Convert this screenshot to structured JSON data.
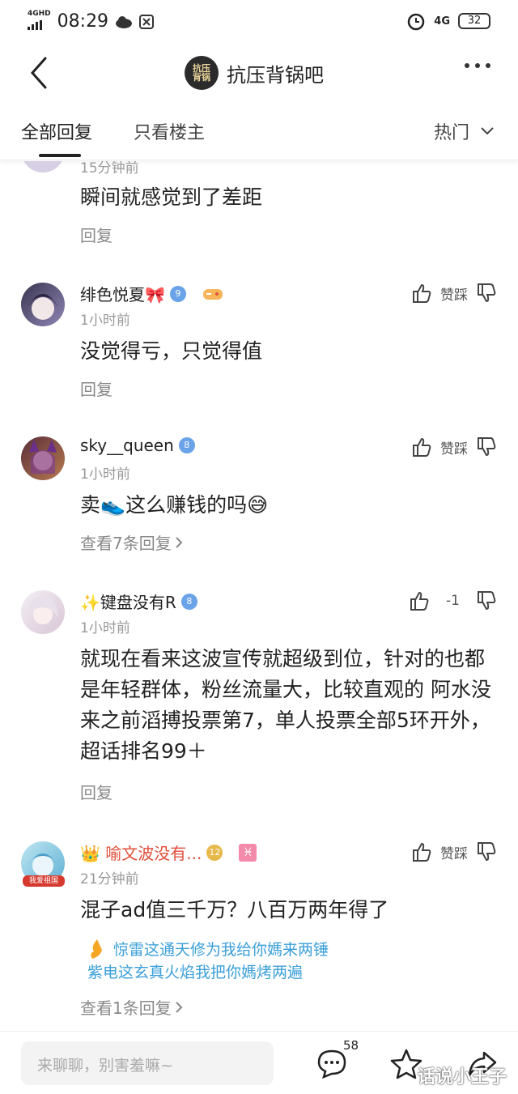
{
  "status_bar": {
    "signal_text": "4GHD",
    "time": "08:29",
    "network": "4G",
    "battery": "32"
  },
  "nav": {
    "forum_name": "抗压背锅吧",
    "forum_avatar_text": "抗压背锅"
  },
  "tabs": {
    "all_replies": "全部回复",
    "op_only": "只看楼主",
    "sort_label": "热门"
  },
  "comments": [
    {
      "time": "15分钟前",
      "text": "瞬间就感觉到了差距",
      "footer": "回复"
    },
    {
      "name": "绯色悦夏🎀",
      "level": "9",
      "time": "1小时前",
      "text": "没觉得亏，只觉得值",
      "footer": "回复",
      "vote_label": "赞踩"
    },
    {
      "name": "sky__queen",
      "level": "8",
      "time": "1小时前",
      "text": "卖👟这么赚钱的吗😅",
      "footer": "查看7条回复",
      "vote_label": "赞踩"
    },
    {
      "name": "✨键盘没有R",
      "level": "8",
      "time": "1小时前",
      "text": "就现在看来这波宣传就超级到位，针对的也都是年轻群体，粉丝流量大，比较直观的 阿水没来之前滔搏投票第7，单人投票全部5环开外，超话排名99＋",
      "footer": "回复",
      "vote_label": "-1"
    },
    {
      "name": "👑 喻文波没有...",
      "level": "12",
      "zodiac": "♓",
      "avatar_tag": "我爱祖国",
      "time": "21分钟前",
      "text": "混子ad值三千万？八百万两年得了",
      "tail_line1": "惊雷这通天修为我给你媽来两锤",
      "tail_line2": "紫电这玄真火焰我把你媽烤两遍",
      "footer": "查看1条回复",
      "vote_label": "赞踩"
    }
  ],
  "bottom_bar": {
    "input_placeholder": "来聊聊，别害羞嘛~",
    "comment_count": "58",
    "watermark": "话说小王子"
  },
  "colors": {
    "vip_name": "#e04e3a",
    "tail_text": "#3b9fd8",
    "level_badge": "#6aa3e8"
  }
}
